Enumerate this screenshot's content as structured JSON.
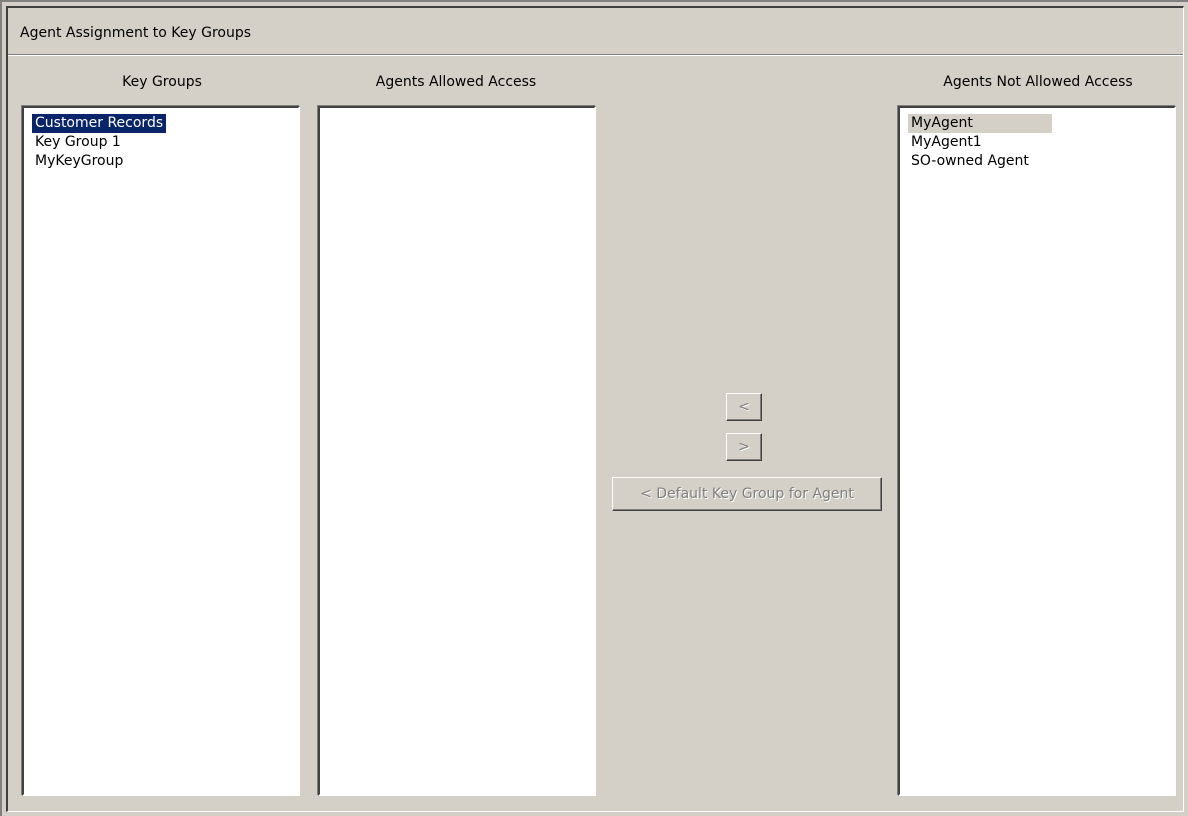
{
  "panel": {
    "title": "Agent Assignment to Key Groups"
  },
  "columns": {
    "key_groups": "Key Groups",
    "agents_allowed": "Agents Allowed Access",
    "agents_not_allowed": "Agents Not Allowed Access"
  },
  "key_groups": {
    "items": [
      "Customer Records",
      "Key Group 1",
      "MyKeyGroup"
    ],
    "selected": "Customer Records"
  },
  "agents_allowed": {
    "items": []
  },
  "agents_not_allowed": {
    "items": [
      "MyAgent",
      "MyAgent1",
      "SO-owned Agent"
    ],
    "highlighted": "MyAgent"
  },
  "buttons": {
    "move_left": "<",
    "move_right": ">",
    "default_key_group": "< Default Key Group for Agent",
    "disabled": true
  },
  "colors": {
    "background": "#d4d0c8",
    "selection": "#0a246a",
    "disabled_text": "#808080"
  }
}
